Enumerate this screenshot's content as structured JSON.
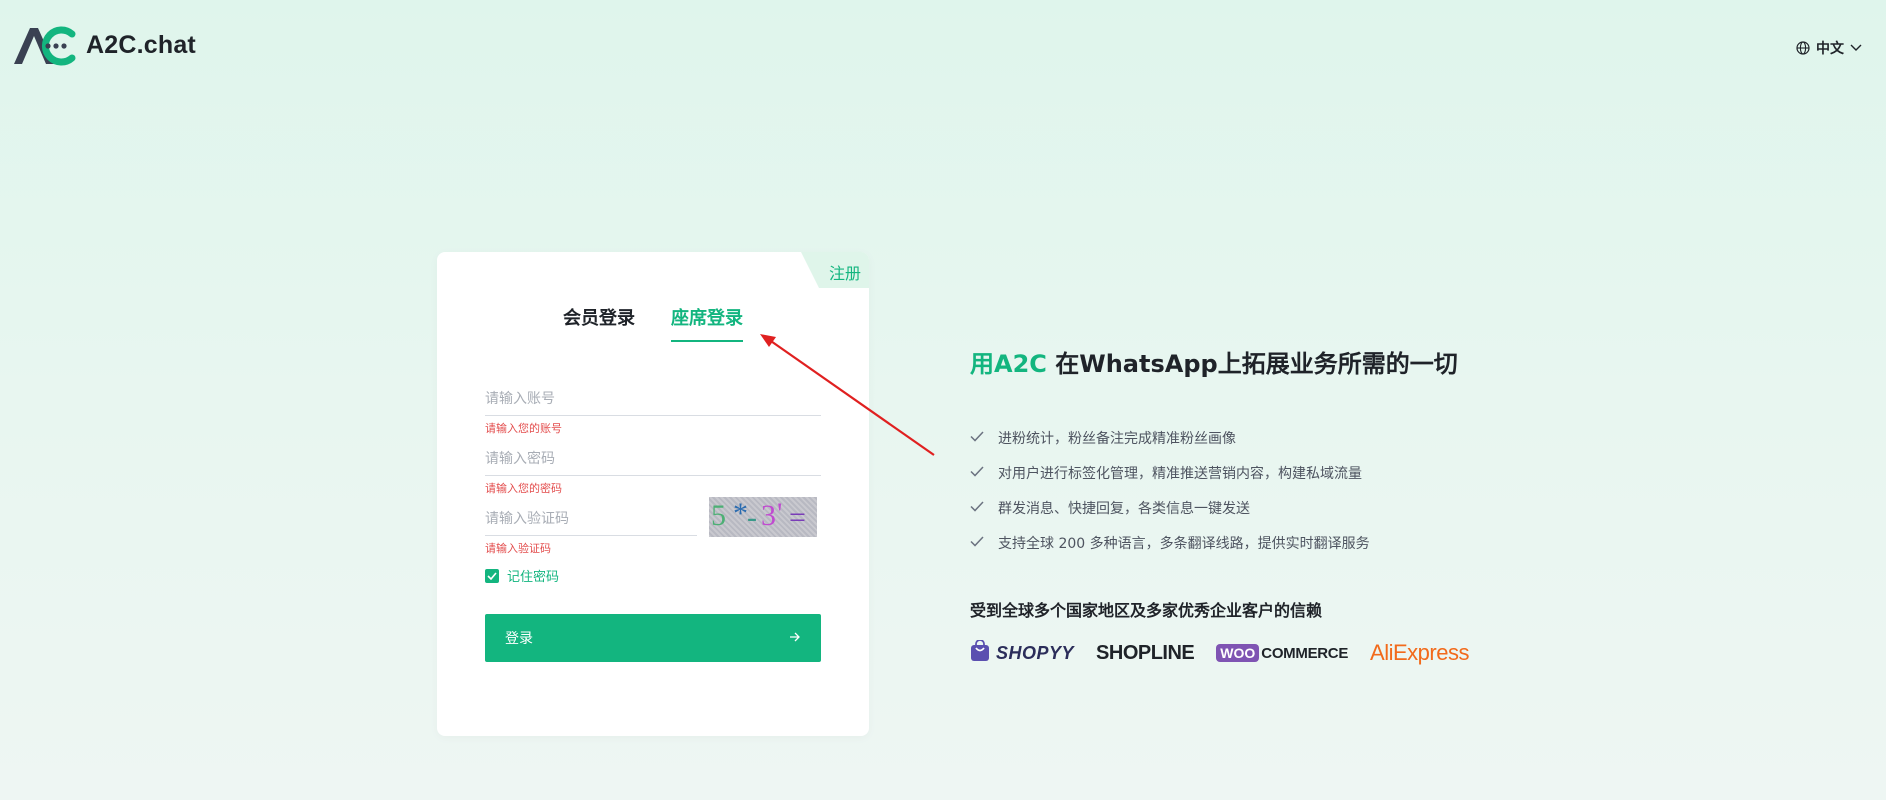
{
  "header": {
    "brand_name": "A2C.chat",
    "language_label": "中文"
  },
  "login_card": {
    "register_label": "注册",
    "tabs": [
      {
        "label": "会员登录",
        "active": false
      },
      {
        "label": "座席登录",
        "active": true
      }
    ],
    "account": {
      "placeholder": "请输入账号",
      "error": "请输入您的账号"
    },
    "password": {
      "placeholder": "请输入密码",
      "error": "请输入您的密码"
    },
    "captcha": {
      "placeholder": "请输入验证码",
      "error": "请输入验证码",
      "image_text": "5*-3'="
    },
    "remember_label": "记住密码",
    "remember_checked": true,
    "login_button_label": "登录"
  },
  "promo": {
    "headline_brand": "用A2C",
    "headline_rest": " 在WhatsApp上拓展业务所需的一切",
    "features": [
      "进粉统计，粉丝备注完成精准粉丝画像",
      "对用户进行标签化管理，精准推送营销内容，构建私域流量",
      "群发消息、快捷回复，各类信息一键发送",
      "支持全球 200 多种语言，多条翻译线路，提供实时翻译服务"
    ],
    "trust_title": "受到全球多个国家地区及多家优秀企业客户的信赖",
    "partners": {
      "shopyy": "SHOPYY",
      "shopline": "SHOPLINE",
      "woo_badge": "WOO",
      "woo_text": "COMMERCE",
      "aliexpress": "AliExpress"
    }
  },
  "colors": {
    "accent": "#13b57f",
    "error": "#e34d4d",
    "annotation_arrow": "#e02020"
  }
}
